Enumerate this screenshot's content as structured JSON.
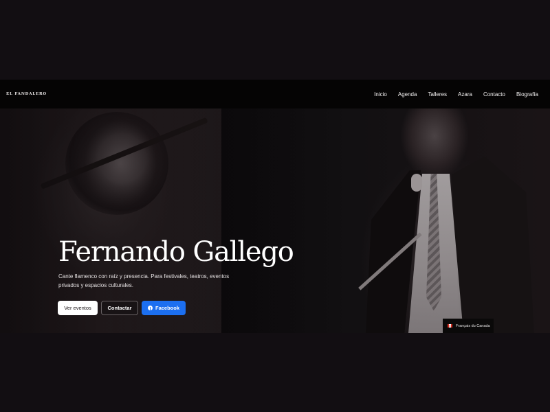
{
  "header": {
    "logo": "EL FANDALERO",
    "nav": [
      {
        "label": "Inicio"
      },
      {
        "label": "Agenda"
      },
      {
        "label": "Talleres"
      },
      {
        "label": "Azara"
      },
      {
        "label": "Contacto"
      },
      {
        "label": "Biografía"
      }
    ]
  },
  "hero": {
    "title": "Fernando Gallego",
    "subtitle": "Cante flamenco con raíz y presencia. Para festivales, teatros, eventos privados y espacios culturales.",
    "buttons": {
      "events": "Ver eventos",
      "contact": "Contactar",
      "facebook": "Facebook"
    }
  },
  "language_badge": {
    "label": "Français du Canada",
    "icon": "canada-flag-icon"
  },
  "colors": {
    "background": "#120e12",
    "navbar": "#050404",
    "facebook_button": "#1c6ff0"
  }
}
